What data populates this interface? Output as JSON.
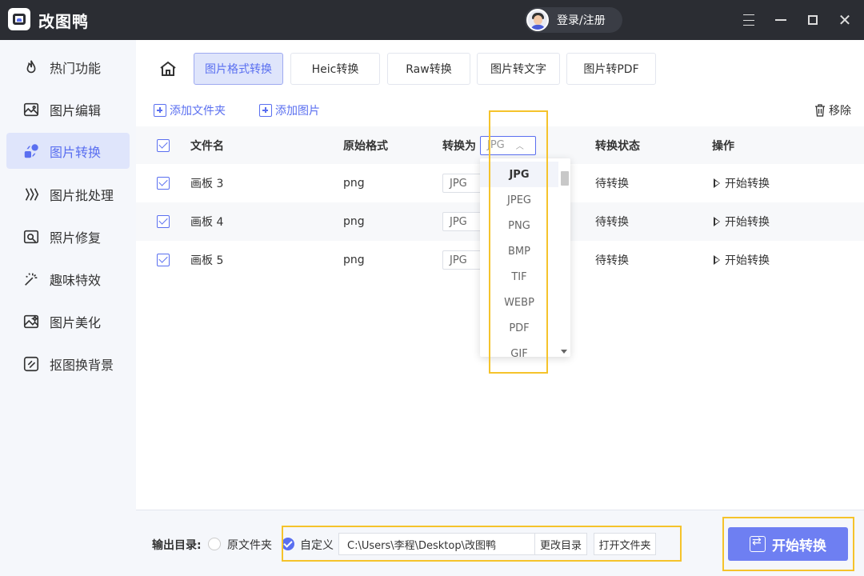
{
  "app": {
    "title": "改图鸭",
    "login_label": "登录/注册"
  },
  "sidebar": {
    "items": [
      {
        "label": "热门功能",
        "icon": "fire-icon"
      },
      {
        "label": "图片编辑",
        "icon": "image-edit-icon"
      },
      {
        "label": "图片转换",
        "icon": "convert-icon",
        "active": true
      },
      {
        "label": "图片批处理",
        "icon": "batch-icon"
      },
      {
        "label": "照片修复",
        "icon": "photo-repair-icon"
      },
      {
        "label": "趣味特效",
        "icon": "magic-wand-icon"
      },
      {
        "label": "图片美化",
        "icon": "beautify-icon"
      },
      {
        "label": "抠图换背景",
        "icon": "cutout-icon"
      }
    ]
  },
  "tabs": [
    {
      "label": "图片格式转换",
      "active": true
    },
    {
      "label": "Heic转换"
    },
    {
      "label": "Raw转换"
    },
    {
      "label": "图片转文字"
    },
    {
      "label": "图片转PDF"
    }
  ],
  "toolbar": {
    "add_folder": "添加文件夹",
    "add_image": "添加图片",
    "remove": "移除"
  },
  "table": {
    "headers": {
      "filename": "文件名",
      "original_format": "原始格式",
      "convert_to": "转换为",
      "status": "转换状态",
      "action": "操作"
    },
    "header_select": "JPG",
    "rows": [
      {
        "filename": "画板 3",
        "format": "png",
        "target": "JPG",
        "status": "待转换",
        "action": "开始转换"
      },
      {
        "filename": "画板 4",
        "format": "png",
        "target": "JPG",
        "status": "待转换",
        "action": "开始转换"
      },
      {
        "filename": "画板 5",
        "format": "png",
        "target": "JPG",
        "status": "待转换",
        "action": "开始转换"
      }
    ]
  },
  "dropdown": {
    "options": [
      "JPG",
      "JPEG",
      "PNG",
      "BMP",
      "TIF",
      "WEBP",
      "PDF",
      "GIF"
    ],
    "selected": "JPG"
  },
  "bottom": {
    "output_label": "输出目录:",
    "option_original": "原文件夹",
    "option_custom": "自定义",
    "path": "C:\\Users\\李程\\Desktop\\改图鸭",
    "change_dir": "更改目录",
    "open_folder": "打开文件夹",
    "start": "开始转换"
  },
  "colors": {
    "accent": "#5a6ff0",
    "titlebar": "#2b2d33",
    "highlight": "#f5c32b"
  }
}
